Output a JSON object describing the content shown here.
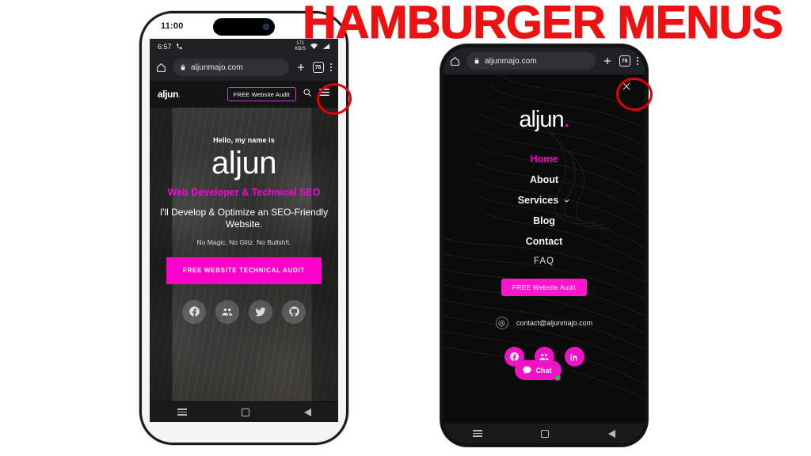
{
  "banner": {
    "title": "HAMBURGER MENUS",
    "color": "#EE1111"
  },
  "theme": {
    "accent": "#FF00CC",
    "accent_alt": "#F209D6",
    "dark_bg": "#0B0B0B",
    "chrome_bg": "#202124"
  },
  "phone_left": {
    "ios_status": {
      "time": "11:00"
    },
    "android_status": {
      "time": "6:57",
      "phone_icon": "phone-icon",
      "net_speed_value": "171",
      "net_speed_unit": "KB/S",
      "wifi_icon": "wifi-icon",
      "signal_icon": "signal-icon"
    },
    "omnibox": {
      "home_icon": "home-icon",
      "lock_icon": "lock-icon",
      "url": "aljunmajo.com",
      "new_tab_icon": "plus-icon",
      "tab_count": "76",
      "menu_icon": "kebab-menu-icon"
    },
    "site_header": {
      "logo": "aljun",
      "logo_dot": ".",
      "audit_button": "FREE Website Audit",
      "search_icon": "search-icon",
      "hamburger_icon": "hamburger-icon"
    },
    "hero": {
      "kicker": "Hello, my name is",
      "name": "aljun",
      "role": "Web Developer & Technical SEO",
      "subheadline": "I'll Develop & Optimize an SEO-Friendly Website.",
      "tagline": "No Magic. No Glitz. No Bullsh!t.",
      "cta": "FREE WEBSITE TECHNICAL AUDIT",
      "socials": [
        {
          "name": "facebook-icon",
          "glyph": "f"
        },
        {
          "name": "meetup-group-icon",
          "glyph": "group"
        },
        {
          "name": "twitter-icon",
          "glyph": "bird"
        },
        {
          "name": "github-icon",
          "glyph": "cat"
        }
      ]
    },
    "nav_bar": {
      "recents_icon": "recents-hamburger-icon",
      "home_icon": "home-square-icon",
      "back_icon": "back-triangle-icon"
    }
  },
  "phone_right": {
    "omnibox": {
      "home_icon": "home-icon",
      "lock_icon": "lock-icon",
      "url": "aljunmajo.com",
      "new_tab_icon": "plus-icon",
      "tab_count": "76",
      "menu_icon": "kebab-menu-icon"
    },
    "menu": {
      "close_icon": "close-x-icon",
      "logo": "aljun",
      "logo_dot": ".",
      "items": [
        {
          "label": "Home",
          "active": true,
          "has_chevron": false
        },
        {
          "label": "About",
          "active": false,
          "has_chevron": false
        },
        {
          "label": "Services",
          "active": false,
          "has_chevron": true
        },
        {
          "label": "Blog",
          "active": false,
          "has_chevron": false
        },
        {
          "label": "Contact",
          "active": false,
          "has_chevron": false
        },
        {
          "label": "FAQ",
          "active": false,
          "has_chevron": false
        }
      ],
      "audit_button": "FREE Website Audit",
      "contact_email": "contact@aljunmajo.com",
      "contact_icon": "at-sign-icon",
      "socials": [
        {
          "name": "facebook-icon",
          "glyph": "f"
        },
        {
          "name": "meetup-group-icon",
          "glyph": "group"
        },
        {
          "name": "linkedin-icon",
          "glyph": "in"
        }
      ],
      "chat_widget": {
        "label": "Chat",
        "icon": "chat-bubble-icon",
        "status": "online"
      }
    },
    "nav_bar": {
      "recents_icon": "recents-hamburger-icon",
      "home_icon": "home-square-icon",
      "back_icon": "back-triangle-icon"
    }
  },
  "annotations": [
    {
      "name": "hamburger-highlight",
      "shape": "circle",
      "color": "#E40000"
    },
    {
      "name": "close-highlight",
      "shape": "circle",
      "color": "#E40000"
    }
  ]
}
